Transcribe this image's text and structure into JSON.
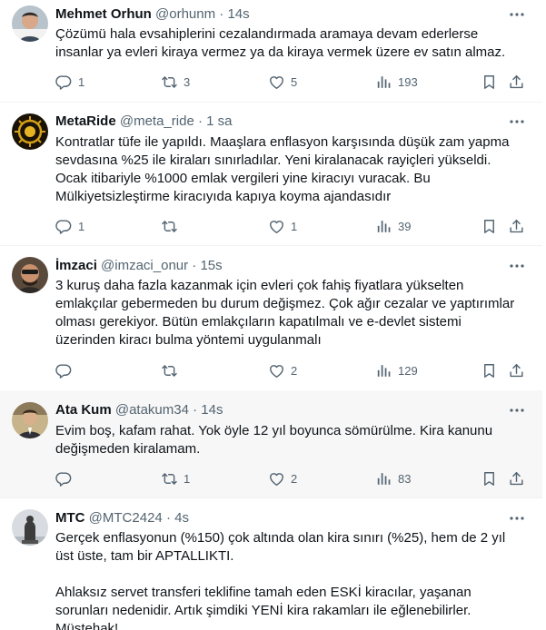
{
  "tweets": [
    {
      "name": "Mehmet Orhun",
      "handle": "@orhunm",
      "sep": "·",
      "time": "14s",
      "text": "Çözümü hala evsahiplerini cezalandırmada aramaya devam ederlerse\ninsanlar ya evleri kiraya vermez ya da kiraya vermek üzere ev satın almaz.",
      "replies": "1",
      "retweets": "3",
      "likes": "5",
      "views": "193"
    },
    {
      "name": "MetaRide",
      "handle": "@meta_ride",
      "sep": "·",
      "time": "1 sa",
      "text": "Kontratlar tüfe ile yapıldı. Maaşlara enflasyon karşısında düşük zam yapma\nsevdasına %25 ile kiraları sınırladılar. Yeni kiralanacak rayiçleri yükseldi.\nOcak itibariyle %1000 emlak vergileri yine kiracıyı vuracak. Bu\nMülkiyetsizleştirme kiracıyıda kapıya koyma ajandasıdır",
      "replies": "1",
      "retweets": "",
      "likes": "1",
      "views": "39"
    },
    {
      "name": "İmzaci",
      "handle": "@imzaci_onur",
      "sep": "·",
      "time": "15s",
      "text": "3 kuruş daha fazla kazanmak için evleri çok fahiş fiyatlara yükselten\nemlakçılar gebermeden bu durum değişmez. Çok ağır cezalar ve yaptırımlar\nolması gerekiyor. Bütün emlakçıların kapatılmalı ve e-devlet sistemi\nüzerinden kiracı bulma yöntemi uygulanmalı",
      "replies": "",
      "retweets": "",
      "likes": "2",
      "views": "129"
    },
    {
      "name": "Ata Kum",
      "handle": "@atakum34",
      "sep": "·",
      "time": "14s",
      "text": "Evim boş, kafam rahat. Yok öyle 12 yıl boyunca sömürülme. Kira kanunu\ndeğişmeden kiralamam.",
      "replies": "",
      "retweets": "1",
      "likes": "2",
      "views": "83"
    },
    {
      "name": "MTC",
      "handle": "@MTC2424",
      "sep": "·",
      "time": "4s",
      "text": "Gerçek enflasyonun (%150) çok altında olan kira sınırı (%25), hem de 2 yıl\nüst üste, tam bir APTALLIKTI.\n\nAhlaksız servet transferi teklifine tamah eden ESKİ kiracılar, yaşanan\nsorunları nedenidir. Artık şimdiki YENİ kira rakamları ile eğlenebilirler.\nMüstehak!"
    }
  ],
  "icons": {
    "more": "more-horizontal-icon",
    "reply": "reply-icon",
    "retweet": "retweet-icon",
    "like": "heart-icon",
    "views": "views-chart-icon",
    "bookmark": "bookmark-icon",
    "share": "share-icon"
  },
  "colors": {
    "text": "#0f1419",
    "muted": "#536471",
    "divider": "#eff3f4",
    "hover_bg": "#f7f7f7"
  }
}
